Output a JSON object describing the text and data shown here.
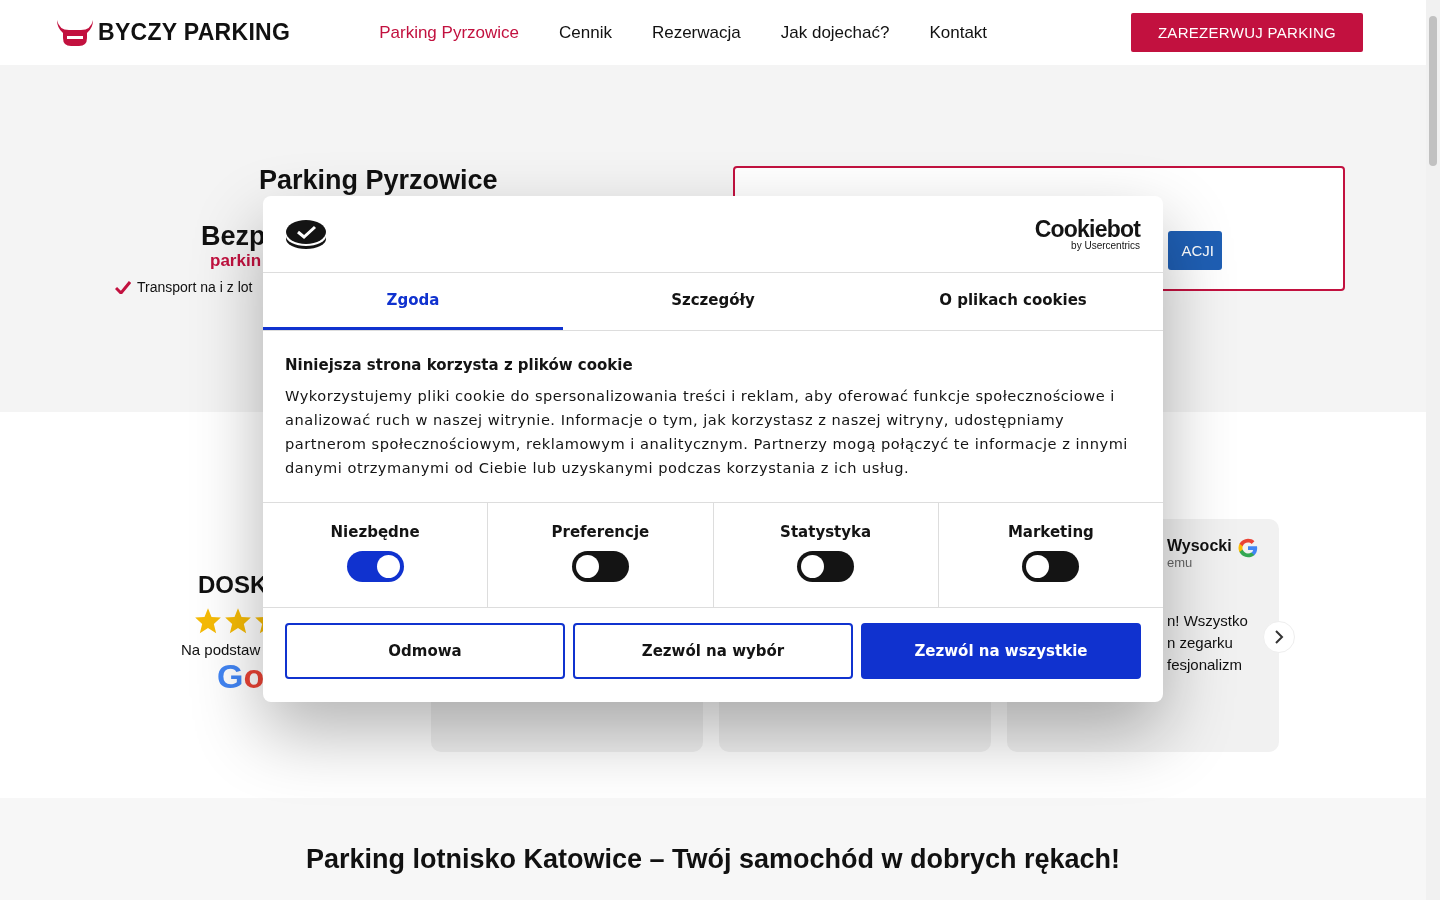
{
  "header": {
    "logo": "BYCZY PARKING",
    "nav": [
      {
        "label": "Parking Pyrzowice",
        "selected": true
      },
      {
        "label": "Cennik",
        "selected": false
      },
      {
        "label": "Rezerwacja",
        "selected": false
      },
      {
        "label": "Jak dojechać?",
        "selected": false
      },
      {
        "label": "Kontakt",
        "selected": false
      }
    ],
    "cta": "ZAREZERWUJ PARKING"
  },
  "hero": {
    "title": "Parking Pyrzowice",
    "headline": "Bezp",
    "subheadline": "parkin",
    "features": [
      "Transport na i z lot"
    ],
    "form": {
      "button": "ACJI"
    }
  },
  "reviews": {
    "heading": "DOSK",
    "caption": "Na podstaw",
    "source": "Go",
    "cards": [
      {
        "kind": "hidden"
      },
      {
        "kind": "hidden"
      },
      {
        "kind": "review",
        "name": "Wysocki",
        "date": "emu",
        "lines": [
          "n! Wszystko",
          "n zegarku",
          "fesjonalizm"
        ]
      }
    ]
  },
  "section": {
    "heading": "Parking lotnisko Katowice – Twój samochód w dobrych rękach!"
  },
  "cookie_dialog": {
    "brand": "Cookiebot",
    "brand_sub": "by Usercentrics",
    "tabs": [
      {
        "label": "Zgoda",
        "selected": true
      },
      {
        "label": "Szczegóły",
        "selected": false
      },
      {
        "label": "O plikach cookies",
        "selected": false
      }
    ],
    "title": "Niniejsza strona korzysta z plików cookie",
    "text": "Wykorzystujemy pliki cookie do spersonalizowania treści i reklam, aby oferować funkcje społecznościowe i analizować ruch w naszej witrynie. Informacje o tym, jak korzystasz z naszej witryny, udostępniamy partnerom społecznościowym, reklamowym i analitycznym. Partnerzy mogą połączyć te informacje z innymi danymi otrzymanymi od Ciebie lub uzyskanymi podczas korzystania z ich usług.",
    "categories": [
      {
        "label": "Niezbędne",
        "checked": true
      },
      {
        "label": "Preferencje",
        "checked": false
      },
      {
        "label": "Statystyka",
        "checked": false
      },
      {
        "label": "Marketing",
        "checked": false
      }
    ],
    "buttons": [
      {
        "label": "Odmowa",
        "kind": "outline"
      },
      {
        "label": "Zezwól na wybór",
        "kind": "outline"
      },
      {
        "label": "Zezwól na wszystkie",
        "kind": "primary"
      }
    ]
  }
}
